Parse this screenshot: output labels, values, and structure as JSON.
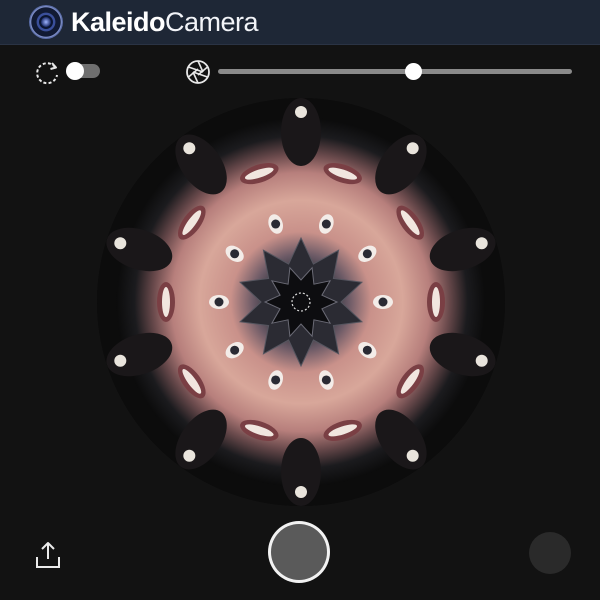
{
  "app": {
    "title_bold": "Kaleido",
    "title_light": "Camera",
    "logo_icon": "camera-lens-icon"
  },
  "toolbar": {
    "rotate_icon": "rotate-icon",
    "auto_rotate_toggle": {
      "on": false
    },
    "aperture_icon": "aperture-icon",
    "segments_slider": {
      "value_fraction": 0.55
    }
  },
  "viewfinder": {
    "center_icon": "focus-dashed-circle-icon"
  },
  "bottom": {
    "share_icon": "share-icon",
    "shutter_icon": "shutter-button",
    "gallery_icon": "gallery-thumbnail"
  },
  "colors": {
    "titlebar": "#1e2736",
    "background": "#121212",
    "accent": "#ffffff",
    "track": "#8a8a8a"
  }
}
